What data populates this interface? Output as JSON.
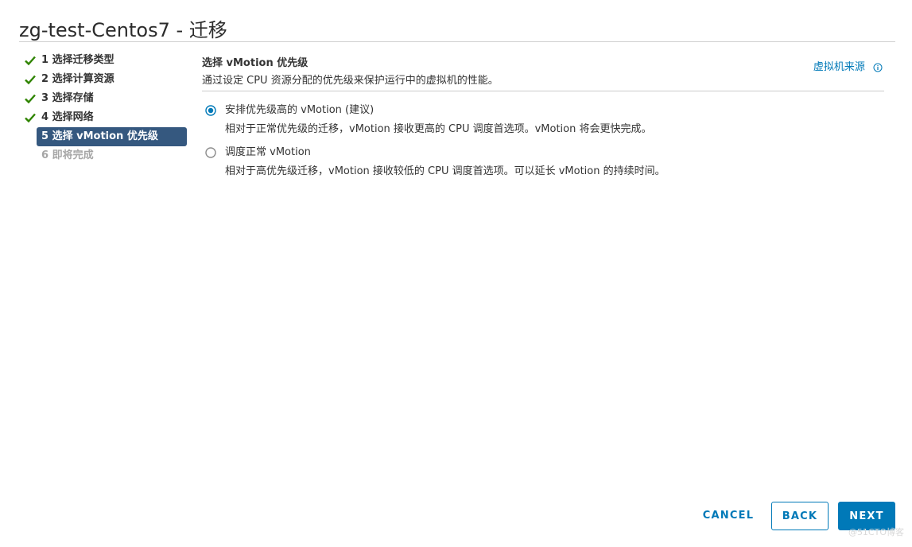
{
  "dialog": {
    "title": "zg-test-Centos7 - 迁移"
  },
  "steps": [
    {
      "label": "1 选择迁移类型",
      "state": "completed"
    },
    {
      "label": "2 选择计算资源",
      "state": "completed"
    },
    {
      "label": "3 选择存储",
      "state": "completed"
    },
    {
      "label": "4 选择网络",
      "state": "completed"
    },
    {
      "label": "5 选择 vMotion 优先级",
      "state": "active"
    },
    {
      "label": "6 即将完成",
      "state": "disabled"
    }
  ],
  "content": {
    "title": "选择 vMotion 优先级",
    "description": "通过设定 CPU 资源分配的优先级来保护运行中的虚拟机的性能。",
    "source_link": "虚拟机来源",
    "source_icon": "info-icon",
    "options": [
      {
        "label": "安排优先级高的 vMotion (建议)",
        "description": "相对于正常优先级的迁移，vMotion 接收更高的 CPU 调度首选项。vMotion 将会更快完成。",
        "selected": true
      },
      {
        "label": "调度正常 vMotion",
        "description": "相对于高优先级迁移，vMotion 接收较低的 CPU 调度首选项。可以延长 vMotion 的持续时间。",
        "selected": false
      }
    ]
  },
  "footer": {
    "cancel_label": "CANCEL",
    "back_label": "BACK",
    "next_label": "NEXT"
  },
  "watermark": "@51CTO博客",
  "colors": {
    "accent": "#0079b8",
    "active_step_bg": "#35587f",
    "check": "#2f8400",
    "disabled_text": "#a6a6a6"
  }
}
